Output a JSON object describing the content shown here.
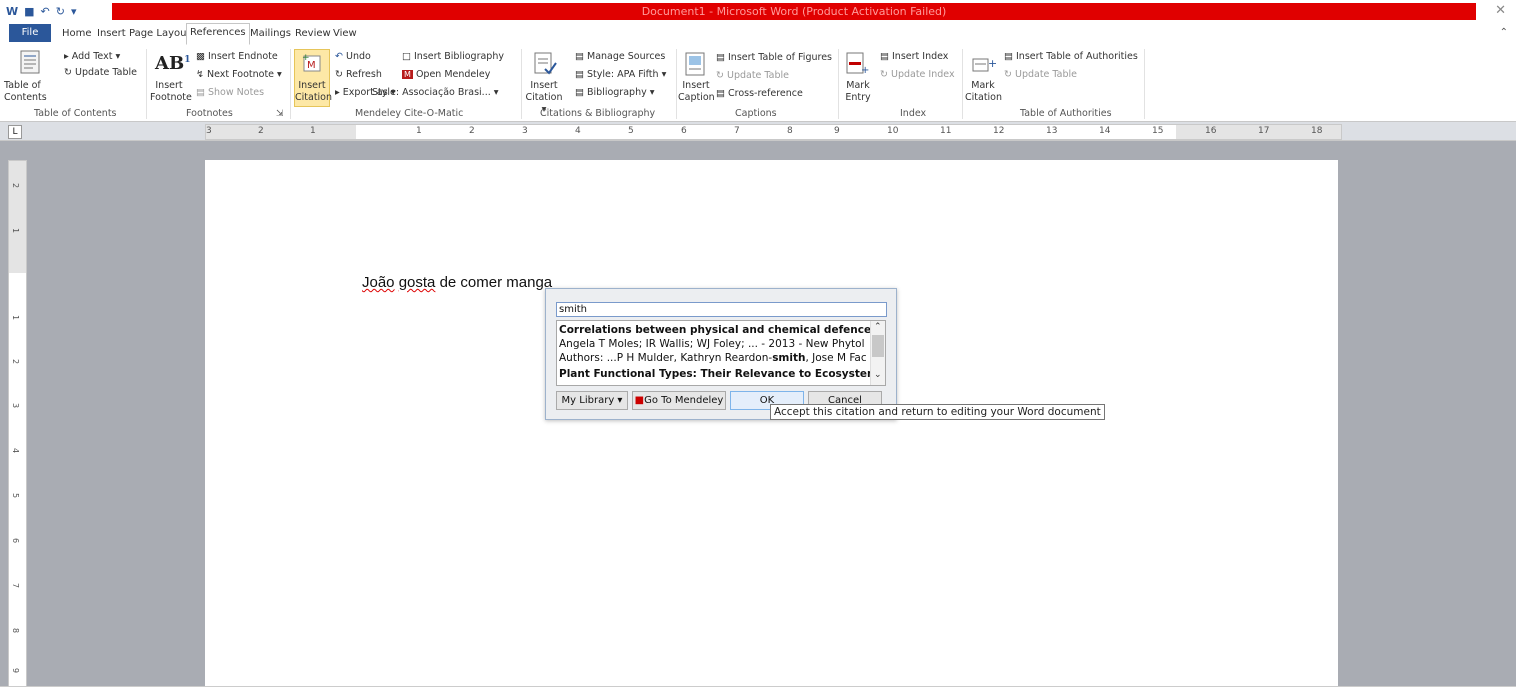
{
  "window": {
    "title": "Document1 - Microsoft Word (Product Activation Failed)"
  },
  "tabs": [
    "File",
    "Home",
    "Insert",
    "Page Layout",
    "References",
    "Mailings",
    "Review",
    "View"
  ],
  "ribbon": {
    "toc": {
      "table_of_contents": "Table of Contents",
      "add_text": "Add Text",
      "update_table": "Update Table",
      "group": "Table of Contents"
    },
    "footnotes": {
      "insert_footnote": "Insert Footnote",
      "insert_endnote": "Insert Endnote",
      "next_footnote": "Next Footnote",
      "show_notes": "Show Notes",
      "group": "Footnotes"
    },
    "mendeley": {
      "insert_citation": "Insert Citation",
      "undo": "Undo",
      "refresh": "Refresh",
      "export_as": "Export as",
      "insert_bibliography": "Insert Bibliography",
      "open_mendeley": "Open Mendeley",
      "style": "Style: Associação Brasi...",
      "group": "Mendeley Cite-O-Matic"
    },
    "citations": {
      "insert_citation": "Insert Citation",
      "manage_sources": "Manage Sources",
      "style": "Style: APA Fifth",
      "bibliography": "Bibliography",
      "group": "Citations & Bibliography"
    },
    "captions": {
      "insert_caption": "Insert Caption",
      "insert_table_of_figures": "Insert Table of Figures",
      "update_table": "Update Table",
      "cross_reference": "Cross-reference",
      "group": "Captions"
    },
    "index": {
      "mark_entry": "Mark Entry",
      "insert_index": "Insert Index",
      "update_index": "Update Index",
      "group": "Index"
    },
    "authorities": {
      "mark_citation": "Mark Citation",
      "insert_table_of_authorities": "Insert Table of Authorities",
      "update_table": "Update Table",
      "group": "Table of Authorities"
    }
  },
  "ruler": [
    "3",
    "2",
    "1",
    "1",
    "2",
    "3",
    "4",
    "5",
    "6",
    "7",
    "8",
    "9",
    "10",
    "11",
    "12",
    "13",
    "14",
    "15",
    "16",
    "17",
    "18"
  ],
  "vruler": [
    "2",
    "1",
    "1",
    "2",
    "3",
    "4",
    "5",
    "6",
    "7",
    "8",
    "9"
  ],
  "document": {
    "word1": "João",
    "word2": "gosta",
    "rest": "de comer manga"
  },
  "dialog": {
    "search_value": "smith",
    "results": [
      {
        "text": "Correlations between physical and chemical defences ir",
        "bold": true
      },
      {
        "text": "Angela T Moles; IR Wallis; WJ Foley; ... - 2013 - New Phytol",
        "bold": false
      },
      {
        "prefix": "Authors: ...P H Mulder, Kathryn Reardon-",
        "match": "smith",
        "suffix": ", Jose M Fac"
      },
      {
        "text": "Plant Functional Types: Their Relevance to Ecosystem P",
        "bold": true
      }
    ],
    "library": "My Library",
    "go_to_mendeley": "Go To Mendeley",
    "ok": "OK",
    "cancel": "Cancel"
  },
  "tooltip": "Accept this citation and return to editing your Word document",
  "colors": {
    "title_red": "#e00000",
    "file_tab": "#2b579a",
    "dialog_bg": "#eceef1"
  }
}
